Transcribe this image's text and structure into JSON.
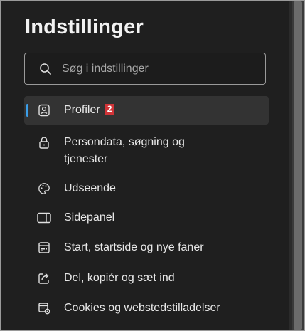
{
  "title": "Indstillinger",
  "search": {
    "placeholder": "Søg i indstillinger",
    "icon": "search-icon"
  },
  "nav": {
    "items": [
      {
        "label": "Profiler",
        "icon": "profile-icon",
        "selected": true,
        "badge": "2"
      },
      {
        "label": "Persondata, søgning og",
        "label2": "tjenester",
        "icon": "lock-icon"
      },
      {
        "label": "Udseende",
        "icon": "palette-icon"
      },
      {
        "label": "Sidepanel",
        "icon": "sidepanel-icon"
      },
      {
        "label": "Start, startside og nye faner",
        "icon": "home-grid-icon"
      },
      {
        "label": "Del, kopiér og sæt ind",
        "icon": "share-icon"
      },
      {
        "label": "Cookies og webstedstilladelser",
        "icon": "cookies-icon"
      }
    ]
  },
  "colors": {
    "background": "#1f1f1f",
    "selected": "#333333",
    "accent": "#3b9ee8",
    "badge": "#d13438",
    "text": "#e8e8e8"
  }
}
